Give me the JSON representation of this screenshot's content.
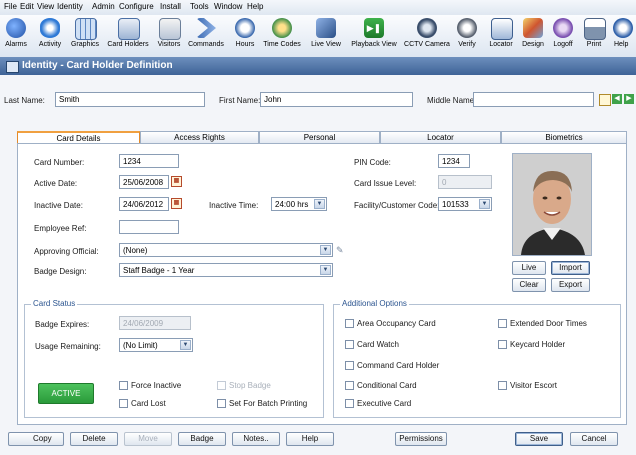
{
  "menu": [
    "File",
    "Edit",
    "View",
    "Identity",
    "Admin",
    "Configure",
    "Install",
    "Tools",
    "Window",
    "Help"
  ],
  "toolbar": [
    "Alarms",
    "Activity",
    "Graphics",
    "Card Holders",
    "Visitors",
    "Commands",
    "Hours",
    "Time Codes",
    "Live View",
    "Playback View",
    "CCTV Camera",
    "Verify",
    "Locator",
    "Design",
    "Logoff",
    "Print",
    "Help"
  ],
  "window_title": "Identity - Card Holder Definition",
  "name_row": {
    "last_name_label": "Last Name:",
    "last_name": "Smith",
    "first_name_label": "First Name:",
    "first_name": "John",
    "middle_name_label": "Middle Name:",
    "middle_name": ""
  },
  "tabs": [
    "Card Details",
    "Access Rights",
    "Personal",
    "Locator",
    "Biometrics"
  ],
  "card": {
    "card_number_label": "Card Number:",
    "card_number": "1234",
    "active_date_label": "Active Date:",
    "active_date": "25/06/2008",
    "inactive_date_label": "Inactive Date:",
    "inactive_date": "24/06/2012",
    "inactive_time_label": "Inactive Time:",
    "inactive_time": "24:00 hrs",
    "employee_ref_label": "Employee Ref:",
    "employee_ref": "",
    "approving_official_label": "Approving Official:",
    "approving_official": "(None)",
    "badge_design_label": "Badge Design:",
    "badge_design": "Staff Badge - 1 Year",
    "pin_code_label": "PIN Code:",
    "pin_code": "1234",
    "card_issue_level_label": "Card Issue Level:",
    "card_issue_level": "0",
    "facility_code_label": "Facility/Customer Code:",
    "facility_code": "101533"
  },
  "photo_buttons": [
    "Live",
    "Import",
    "Clear",
    "Export"
  ],
  "card_status": {
    "title": "Card Status",
    "badge_expires_label": "Badge Expires:",
    "badge_expires": "24/06/2009",
    "usage_remaining_label": "Usage Remaining:",
    "usage_remaining": "(No Limit)",
    "status_button": "ACTIVE",
    "force_inactive": "Force Inactive",
    "stop_badge": "Stop Badge",
    "card_lost": "Card Lost",
    "set_for_batch_printing": "Set For Batch Printing"
  },
  "additional_options": {
    "title": "Additional Options",
    "left": [
      "Area Occupancy Card",
      "Card Watch",
      "Command Card Holder",
      "Conditional Card",
      "Executive Card"
    ],
    "right": [
      "Extended Door Times",
      "Keycard Holder",
      "Visitor Escort"
    ]
  },
  "bottom_buttons": {
    "copy": "Copy",
    "delete": "Delete",
    "move": "Move",
    "badge": "Badge",
    "notes": "Notes..",
    "help": "Help",
    "permissions": "Permissions",
    "save": "Save",
    "cancel": "Cancel"
  }
}
